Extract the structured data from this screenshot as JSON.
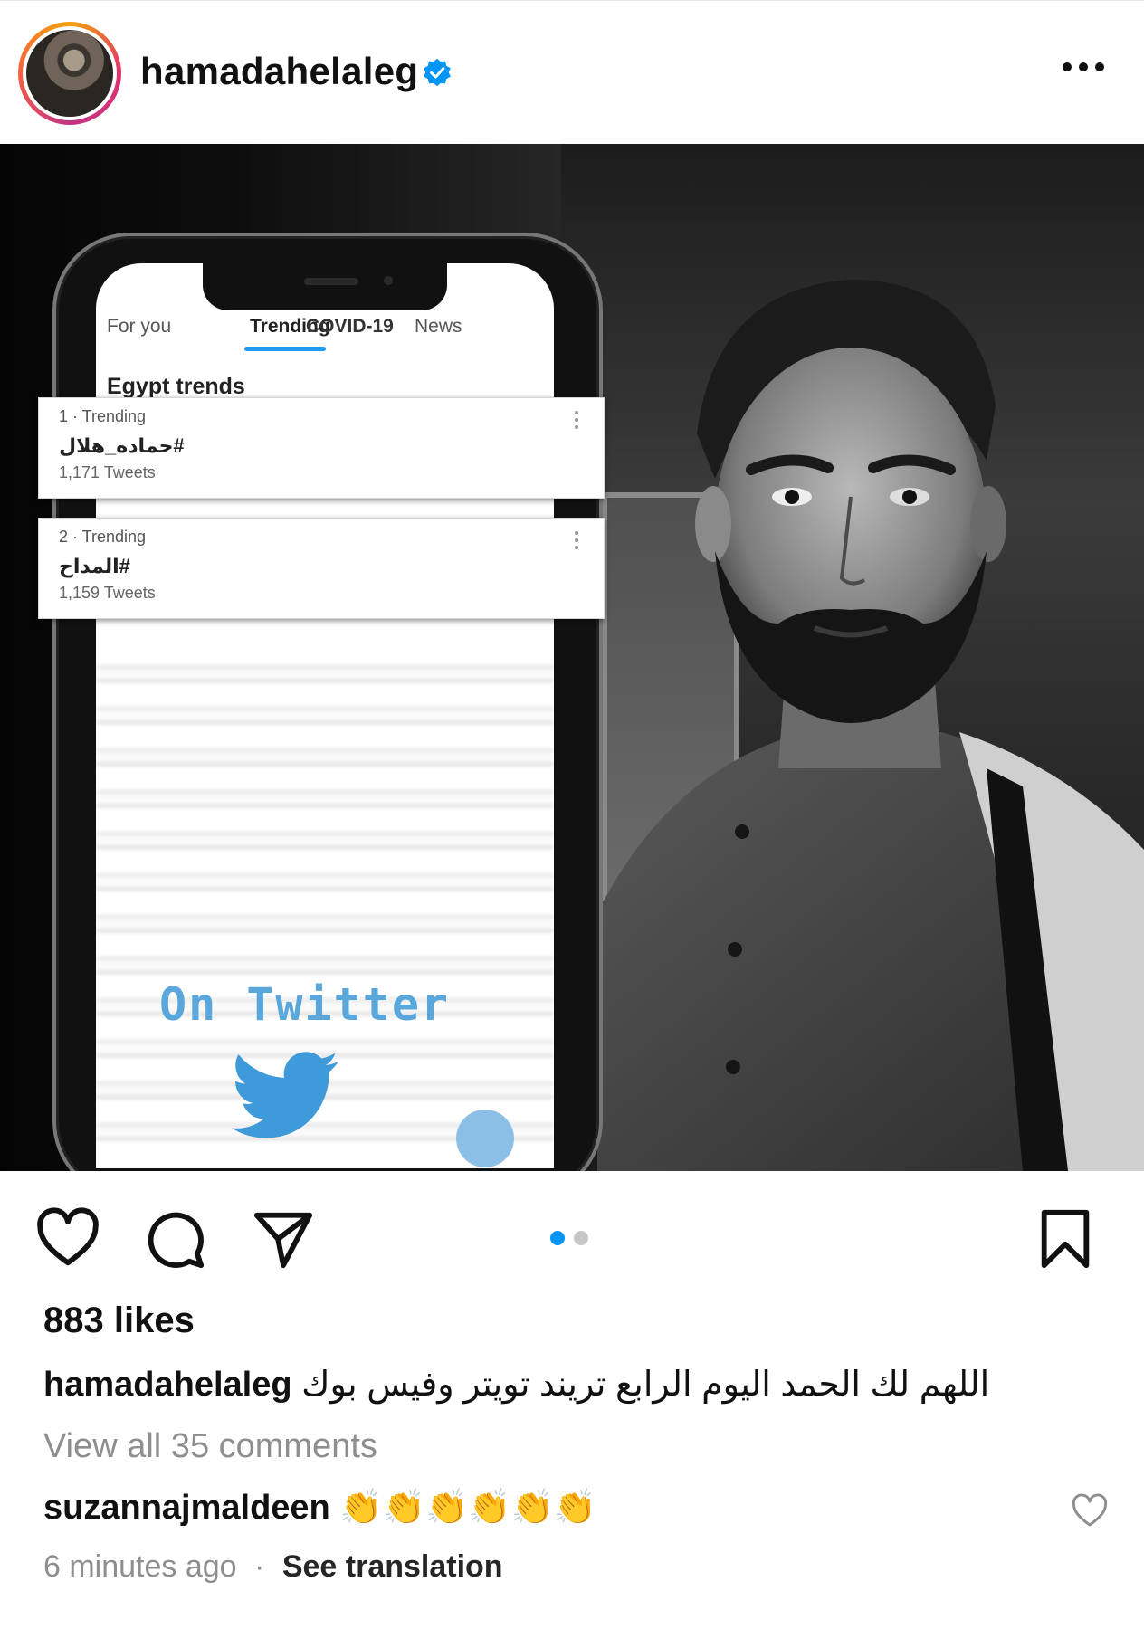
{
  "header": {
    "username": "hamadahelaleg"
  },
  "post_image": {
    "tabs": [
      "For you",
      "Trending",
      "COVID-19",
      "News"
    ],
    "section_title": "Egypt trends",
    "trends": [
      {
        "rank": "1 · Trending",
        "tag": "#حماده_هلال",
        "count": "1,171 Tweets"
      },
      {
        "rank": "2 · Trending",
        "tag": "#المداح",
        "count": "1,159 Tweets"
      }
    ],
    "overlay_text": "On Twitter"
  },
  "carousel": {
    "total": 2,
    "active_index": 0,
    "active_color": "#0095f6",
    "inactive_color": "#c7c7c7"
  },
  "likes": "883 likes",
  "caption": {
    "username": "hamadahelaleg",
    "text": "اللهم لك الحمد اليوم الرابع تريند تويتر وفيس بوك"
  },
  "view_all_comments": "View all 35 comments",
  "comment": {
    "username": "suzannajmaldeen",
    "text": "👏👏👏👏👏👏"
  },
  "meta": {
    "time": "6 minutes ago",
    "separator": "·",
    "see_translation": "See translation"
  },
  "colors": {
    "verified": "#0095f6",
    "twitter_blue": "#1d9bf0"
  }
}
